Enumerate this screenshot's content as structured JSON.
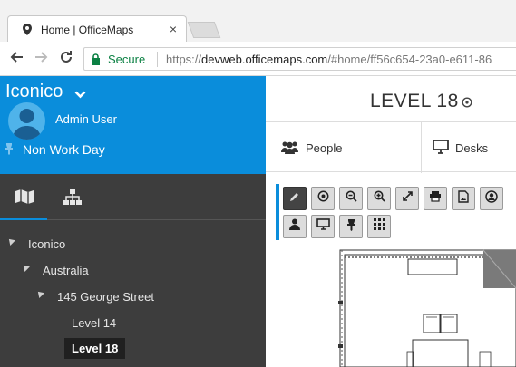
{
  "browser": {
    "tab_title": "Home | OfficeMaps",
    "tab_close": "×",
    "secure_label": "Secure",
    "url_scheme": "https://",
    "url_host": "devweb.officemaps.com",
    "url_path": "/#home/ff56c654-23a0-e611-86",
    "secure_color": "#0b8043"
  },
  "sidebar": {
    "org_name": "Iconico",
    "user_name": "Admin User",
    "work_status": "Non Work Day",
    "accent": "#0a8ddb",
    "tabs": [
      {
        "icon": "map-icon",
        "active": true
      },
      {
        "icon": "org-chart-icon",
        "active": false
      }
    ],
    "tree": [
      {
        "label": "Iconico",
        "level": 0
      },
      {
        "label": "Australia",
        "level": 1
      },
      {
        "label": "145 George Street",
        "level": 2
      },
      {
        "label": "Level 14",
        "level": 3
      },
      {
        "label": "Level 18",
        "level": 3,
        "selected": true
      }
    ]
  },
  "main": {
    "title": "LEVEL 18",
    "tabs": [
      {
        "label": "People",
        "icon": "people-icon"
      },
      {
        "label": "Desks",
        "icon": "monitor-icon"
      }
    ],
    "toolbar": [
      {
        "icon": "pencil-icon",
        "active": true
      },
      {
        "icon": "target-icon"
      },
      {
        "icon": "zoom-out-icon"
      },
      {
        "icon": "zoom-in-icon"
      },
      {
        "icon": "expand-icon"
      },
      {
        "icon": "print-icon"
      },
      {
        "icon": "image-export-icon"
      },
      {
        "icon": "user-circle-icon"
      },
      {
        "icon": "person-icon"
      },
      {
        "icon": "monitor-icon"
      },
      {
        "icon": "pin-icon"
      },
      {
        "icon": "grid-icon"
      }
    ]
  }
}
